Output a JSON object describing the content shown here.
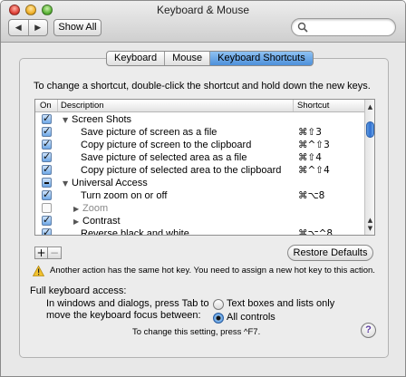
{
  "window": {
    "title": "Keyboard & Mouse"
  },
  "toolbar": {
    "back_glyph": "◀",
    "forward_glyph": "▶",
    "show_all_label": "Show All",
    "search_value": "",
    "search_placeholder": ""
  },
  "tabs": [
    {
      "label": "Keyboard",
      "active": false
    },
    {
      "label": "Mouse",
      "active": false
    },
    {
      "label": "Keyboard Shortcuts",
      "active": true
    }
  ],
  "instructions": "To change a shortcut, double-click the shortcut and hold down the new keys.",
  "table": {
    "columns": {
      "on": "On",
      "description": "Description",
      "shortcut": "Shortcut"
    },
    "rows": [
      {
        "state": "on",
        "level": "group",
        "expanded": true,
        "label": "Screen Shots",
        "shortcut": ""
      },
      {
        "state": "on",
        "level": "item",
        "label": "Save picture of screen as a file",
        "shortcut": "⌘⇧3"
      },
      {
        "state": "on",
        "level": "item",
        "label": "Copy picture of screen to the clipboard",
        "shortcut": "⌘^⇧3"
      },
      {
        "state": "on",
        "level": "item",
        "label": "Save picture of selected area as a file",
        "shortcut": "⌘⇧4"
      },
      {
        "state": "on",
        "level": "item",
        "label": "Copy picture of selected area to the clipboard",
        "shortcut": "⌘^⇧4"
      },
      {
        "state": "mixed",
        "level": "group",
        "expanded": true,
        "label": "Universal Access",
        "shortcut": ""
      },
      {
        "state": "on",
        "level": "item",
        "label": "Turn zoom on or off",
        "shortcut": "⌘⌥8"
      },
      {
        "state": "off",
        "level": "sub",
        "expanded": false,
        "dim": true,
        "label": "Zoom",
        "shortcut": ""
      },
      {
        "state": "on",
        "level": "sub",
        "expanded": false,
        "label": "Contrast",
        "shortcut": ""
      },
      {
        "state": "on",
        "level": "item",
        "label": "Reverse black and white",
        "shortcut": "⌘⌥^8"
      }
    ]
  },
  "buttons": {
    "add": "+",
    "remove": "−",
    "restore_defaults": "Restore Defaults"
  },
  "warning": "Another action has the same hot key. You need to assign a new hot key to this action.",
  "full_keyboard_access": {
    "title": "Full keyboard access:",
    "description_line1": "In windows and dialogs, press Tab to",
    "description_line2": "move the keyboard focus between:",
    "options": [
      {
        "label": "Text boxes and lists only",
        "selected": false
      },
      {
        "label": "All controls",
        "selected": true
      }
    ],
    "hint": "To change this setting, press ^F7."
  },
  "help_label": "?",
  "colors": {
    "accent": "#4d90da",
    "checkbox": "#6da7e6",
    "warning": "#f2c22e"
  }
}
